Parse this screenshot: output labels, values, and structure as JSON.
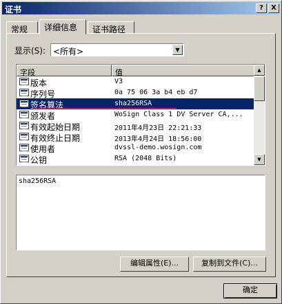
{
  "window": {
    "title": "证书",
    "help_label": "?",
    "close_label": "X"
  },
  "tabs": [
    {
      "label": "常规"
    },
    {
      "label": "详细信息"
    },
    {
      "label": "证书路径"
    }
  ],
  "show": {
    "label": "显示(S):",
    "selected": "<所有>"
  },
  "columns": {
    "field": "字段",
    "value": "值"
  },
  "rows": [
    {
      "field": "版本",
      "value": "V3"
    },
    {
      "field": "序列号",
      "value": "0a 75 06 3a b4 eb d7"
    },
    {
      "field": "签名算法",
      "value": "sha256RSA"
    },
    {
      "field": "颁发者",
      "value": "WoSign Class 1 DV Server CA,..."
    },
    {
      "field": "有效起始日期",
      "value": "2011年4月23日 22:21:33"
    },
    {
      "field": "有效终止日期",
      "value": "2013年4月24日 18:56:00"
    },
    {
      "field": "使用者",
      "value": "dvssl-demo.wosign.com"
    },
    {
      "field": "公钥",
      "value": "RSA (2048 Bits)"
    }
  ],
  "selected_row": 2,
  "detail_text": "sha256RSA",
  "buttons": {
    "edit": "编辑属性(E)...",
    "copy": "复制到文件(C)...",
    "ok": "确定"
  },
  "colors": {
    "selection": "#0a246a",
    "highlight_underline": "#c0203a",
    "face": "#d4d0c8"
  }
}
